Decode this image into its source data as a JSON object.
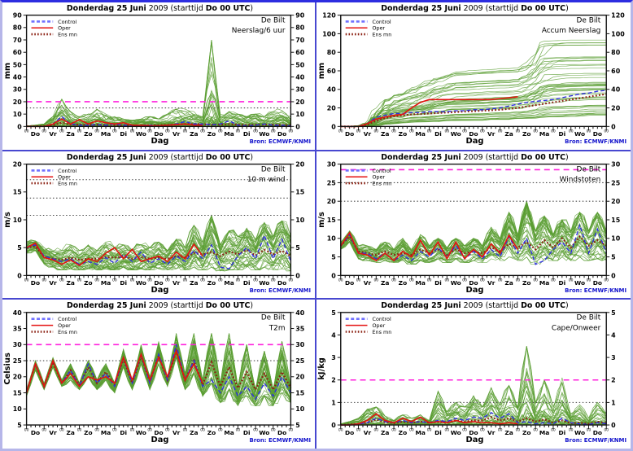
{
  "common": {
    "title_parts": [
      {
        "t": "Donderdag 25 Juni",
        "b": 1
      },
      {
        "t": "   2009  (starttijd  ",
        "b": 0
      },
      {
        "t": "Do 00 ",
        "b": 1
      },
      {
        "t": "UTC",
        "b": 1
      },
      {
        "t": ")",
        "b": 0
      }
    ],
    "location": "De Bilt",
    "legend": [
      {
        "label": "Control",
        "style": "control"
      },
      {
        "label": "Oper",
        "style": "oper"
      },
      {
        "label": "Ens mn",
        "style": "ensmean"
      }
    ],
    "xlabel": "Dag",
    "source": "Bron: ECMWF/KNMI",
    "hour_tick_label": "00",
    "days": [
      "Do",
      "Vr",
      "Za",
      "Zo",
      "Ma",
      "Di",
      "Wo",
      "Do",
      "Vr",
      "Za",
      "Zo",
      "Ma",
      "Di",
      "Wo",
      "Do"
    ],
    "forecast_hours": 360,
    "oper_end_hour": 240,
    "series_step_hours": 12,
    "member_step_hours": 6
  },
  "colors": {
    "ensemble": "#5a9e32",
    "control": "#2e2ee0",
    "control_legend": "#7070ff",
    "oper": "#e41210",
    "ensmean": "#8b2012",
    "magenta_threshold": "#ff22dd",
    "dotted_threshold": "#4a4a4a",
    "axis": "#111111",
    "text": "#000000",
    "source_text": "#1414cc",
    "separator": "#4848d0",
    "border_outer": "#b6b6e9",
    "border_top": "#2d2de0",
    "background": "#ffffff"
  },
  "chart_data": [
    {
      "name": "neerslag-6uur",
      "type": "line",
      "variable": "Neerslag/6 uur",
      "ylabel": "mm",
      "ylim": [
        0,
        90
      ],
      "ystep": 10,
      "magenta_line": 20,
      "dotted_lines": [
        15
      ],
      "skew": 2.4,
      "members": 45,
      "seed": 11,
      "accum": false,
      "control": [
        0,
        0,
        0,
        2,
        8,
        2,
        1,
        1,
        1.5,
        1,
        2,
        1,
        0.5,
        1,
        1,
        0.5,
        1,
        2,
        4,
        2,
        2,
        1.5,
        2,
        4.5,
        1,
        0.5,
        1,
        2,
        1,
        1,
        0.5
      ],
      "oper": [
        0,
        0,
        0,
        2,
        6,
        2,
        5.5,
        2,
        4.5,
        3,
        2,
        3,
        1,
        1,
        0.5,
        0.5,
        1,
        1.5,
        2,
        1,
        1
      ],
      "ensmean": [
        0.2,
        0.2,
        0.3,
        1,
        3,
        1.5,
        1.5,
        1.2,
        1.5,
        1.2,
        1,
        1,
        0.8,
        0.8,
        1,
        1,
        1.2,
        1.5,
        2,
        2,
        1.8,
        1.5,
        1.5,
        1.8,
        1.5,
        1.2,
        1.5,
        1.5,
        1.5,
        1.2,
        1
      ],
      "env_min": null,
      "env_max": [
        0.5,
        1,
        2,
        8,
        22,
        12,
        8,
        10,
        14,
        10,
        8,
        6,
        5,
        6,
        8,
        6,
        10,
        14,
        14,
        12,
        8,
        70,
        10,
        12,
        10,
        8,
        10,
        8,
        12,
        14,
        8
      ]
    },
    {
      "name": "accum-neerslag",
      "type": "line",
      "variable": "Accum Neerslag",
      "ylabel": "mm",
      "ylim": [
        0,
        120
      ],
      "ystep": 20,
      "magenta_line": null,
      "dotted_lines": [],
      "skew": 1,
      "members": 45,
      "seed": 22,
      "accum": true,
      "control": [
        0,
        0,
        0,
        3,
        10,
        12,
        14,
        14,
        15,
        15,
        16,
        16,
        16,
        17,
        17,
        18,
        18,
        19,
        20,
        22,
        24,
        26,
        27,
        28,
        29,
        31,
        33,
        35,
        36,
        38,
        39
      ],
      "oper": [
        0,
        0,
        0,
        3,
        8,
        10,
        12,
        13,
        20,
        26,
        29,
        29,
        29,
        29,
        29,
        29,
        29,
        29,
        30,
        31,
        32
      ],
      "ensmean": [
        0,
        0,
        0,
        2,
        6,
        9,
        11,
        12,
        13,
        13.5,
        14,
        14.5,
        15,
        15.5,
        16,
        16.5,
        17,
        17.5,
        18,
        19,
        20,
        21.5,
        23,
        24.5,
        26,
        27.5,
        29,
        30.5,
        32,
        33.5,
        35
      ],
      "env_min": [
        0,
        0,
        0,
        0,
        1,
        2,
        3,
        3,
        4,
        4,
        4,
        4,
        5,
        5,
        5,
        5,
        5,
        6,
        6,
        6,
        7,
        7,
        7,
        8,
        8,
        8,
        9,
        9,
        10,
        10,
        10
      ],
      "env_max": [
        0,
        0,
        1,
        6,
        20,
        30,
        35,
        38,
        42,
        46,
        50,
        55,
        58,
        60,
        60,
        61,
        62,
        62,
        63,
        63,
        64,
        70,
        80,
        93,
        94,
        94,
        94,
        94,
        94,
        94,
        94
      ]
    },
    {
      "name": "10m-wind",
      "type": "line",
      "variable": "10 m wind",
      "ylabel": "m/s",
      "ylim": [
        0,
        20
      ],
      "ystep": 5,
      "magenta_line": null,
      "dotted_lines": [
        10.8,
        13.9,
        17.2
      ],
      "skew": 1,
      "members": 45,
      "seed": 33,
      "accum": false,
      "control": [
        5,
        5.5,
        3.5,
        3,
        2.5,
        3,
        2,
        2.5,
        2,
        3.2,
        2.2,
        3.8,
        2.5,
        4.2,
        2.2,
        3,
        2,
        3.5,
        2.5,
        4.5,
        3,
        5.5,
        1.5,
        1.2,
        3.5,
        5,
        3,
        7.2,
        3,
        6.5,
        2.5
      ],
      "oper": [
        5,
        5.8,
        3.2,
        2.8,
        2,
        2.8,
        1.8,
        3,
        2.5,
        4,
        5,
        3,
        4.7,
        2.5,
        3,
        3.5,
        2.5,
        4.2,
        3,
        5.6,
        3.5
      ],
      "ensmean": [
        5,
        5.2,
        3.3,
        3,
        2.8,
        3.2,
        2.8,
        3,
        3,
        3.3,
        3.2,
        3.4,
        3,
        3.3,
        3,
        3.2,
        3,
        3.5,
        3.3,
        4,
        3.8,
        4.2,
        3.5,
        4.3,
        3.8,
        4.6,
        3.6,
        4.6,
        3.8,
        4.4,
        3.5
      ],
      "env_min": [
        4,
        4.5,
        2,
        1.5,
        1,
        1.2,
        1,
        1.2,
        1,
        1.2,
        1,
        1.5,
        1,
        1.2,
        1,
        1.2,
        1,
        1.2,
        1,
        1.5,
        1,
        1.5,
        0.8,
        1,
        1,
        1.5,
        1,
        1.5,
        1,
        1.2,
        0.8
      ],
      "env_max": [
        6,
        6.2,
        5,
        4.5,
        4.5,
        5.5,
        4.5,
        5.5,
        4.5,
        6,
        5,
        5.5,
        4.5,
        5.5,
        5,
        6,
        4.5,
        6.5,
        5,
        9,
        6,
        10.8,
        5.5,
        8,
        7,
        8.5,
        6.5,
        9.5,
        7,
        9.8,
        7
      ]
    },
    {
      "name": "windstoten",
      "type": "line",
      "variable": "Windstoten",
      "ylabel": "m/s",
      "ylim": [
        0,
        30
      ],
      "ystep": 5,
      "magenta_line": 28.5,
      "dotted_lines": [
        20,
        25
      ],
      "skew": 1,
      "members": 45,
      "seed": 44,
      "accum": false,
      "control": [
        8,
        11,
        6,
        6,
        4.5,
        6,
        4,
        5.5,
        4,
        6.5,
        5,
        7.5,
        5,
        8,
        4.5,
        6.5,
        4.5,
        7,
        5,
        10.5,
        6,
        10,
        3,
        4,
        7,
        9,
        6,
        13.5,
        6,
        12.5,
        6
      ],
      "oper": [
        8,
        11.5,
        6,
        5.5,
        4,
        6,
        4,
        6.5,
        5,
        9.5,
        5.5,
        9,
        4.5,
        9,
        4.5,
        7,
        5,
        8.5,
        6,
        10.8,
        7
      ],
      "ensmean": [
        8,
        10.5,
        6.5,
        6,
        5.5,
        6.5,
        5.5,
        6,
        5.5,
        7,
        6,
        7,
        5.5,
        7,
        6,
        6.5,
        6,
        7.5,
        6.5,
        8.5,
        7.5,
        9,
        7,
        9.5,
        7.5,
        10,
        7.5,
        10.5,
        8,
        9.5,
        8
      ],
      "env_min": [
        7,
        9,
        4.5,
        4,
        3.5,
        4,
        3.5,
        4,
        3,
        4,
        3.5,
        4.5,
        3.5,
        4.5,
        3.5,
        4,
        3.5,
        4.5,
        4,
        5,
        4,
        5,
        3,
        4,
        4,
        5,
        4,
        5,
        4,
        4.5,
        4
      ],
      "env_max": [
        9,
        12,
        8,
        8,
        7,
        9,
        7,
        10,
        7,
        11,
        8,
        10,
        7.5,
        10,
        8,
        10,
        8,
        13,
        10,
        17,
        11,
        20,
        12,
        16,
        11,
        15,
        12,
        17,
        12,
        17,
        12
      ]
    },
    {
      "name": "t2m",
      "type": "line",
      "variable": "T2m",
      "ylabel": "Celsius",
      "ylim": [
        5,
        40
      ],
      "ystep": 5,
      "magenta_line": 30,
      "dotted_lines": [
        25
      ],
      "skew": 1,
      "members": 45,
      "seed": 55,
      "accum": false,
      "control": [
        15,
        24,
        17,
        25,
        18,
        22,
        17,
        24,
        18,
        21,
        17,
        26,
        18,
        27,
        18,
        27,
        19,
        30,
        19,
        25,
        17,
        19,
        15,
        20,
        14,
        17,
        13,
        18,
        14,
        20,
        15
      ],
      "oper": [
        15,
        24,
        17,
        25,
        18,
        21,
        17,
        20,
        19,
        20,
        18,
        26,
        19,
        27,
        19,
        26,
        20,
        28,
        19,
        24,
        18
      ],
      "ensmean": [
        15,
        24,
        17,
        24.5,
        18,
        22,
        17.5,
        23,
        18,
        21.5,
        17.5,
        25.5,
        18,
        26.5,
        18.5,
        26.5,
        19,
        28,
        19,
        25,
        17.5,
        24.5,
        17,
        23,
        16.5,
        21.5,
        16,
        21,
        16,
        21.5,
        16.5
      ],
      "env_min": [
        14,
        22,
        16,
        23,
        17,
        19,
        16,
        20,
        16,
        19,
        15,
        23,
        16,
        24,
        16,
        24,
        17,
        26,
        16,
        21,
        14,
        18,
        12,
        16,
        11,
        14,
        11,
        14,
        11,
        15,
        12
      ],
      "env_max": [
        16,
        25,
        18,
        26,
        19,
        24,
        18,
        25,
        19,
        24,
        18,
        28.5,
        19,
        30,
        20,
        31,
        20,
        33.5,
        21,
        33.5,
        19,
        33.5,
        18,
        33.5,
        17,
        30,
        16,
        28,
        16,
        31,
        17
      ]
    },
    {
      "name": "cape-onweer",
      "type": "line",
      "variable": "Cape/Onweer",
      "ylabel": "kJ/kg",
      "ylim": [
        0,
        5
      ],
      "ystep": 1,
      "magenta_line": 2,
      "dotted_lines": [
        1
      ],
      "skew": 2.6,
      "members": 45,
      "seed": 66,
      "accum": false,
      "control": [
        0,
        0,
        0.05,
        0.1,
        0.3,
        0.15,
        0.1,
        0.2,
        0.1,
        0.15,
        0.1,
        0.2,
        0.15,
        0.3,
        0.2,
        0.35,
        0.3,
        0.55,
        0.3,
        0.5,
        0.1,
        0.15,
        0.05,
        0.1,
        0.05,
        0.3,
        0.1,
        0.05,
        0.02,
        0.1,
        0.05
      ],
      "oper": [
        0,
        0,
        0.05,
        0.2,
        0.5,
        0.2,
        0.1,
        0.3,
        0.15,
        0.35,
        0.1,
        0.15,
        0.1,
        0.2,
        0.1,
        0.15,
        0.1,
        0.1,
        0.05,
        0.1,
        0.05
      ],
      "ensmean": [
        0,
        0.02,
        0.05,
        0.1,
        0.25,
        0.12,
        0.08,
        0.15,
        0.1,
        0.15,
        0.1,
        0.15,
        0.12,
        0.2,
        0.15,
        0.2,
        0.2,
        0.35,
        0.2,
        0.3,
        0.15,
        0.3,
        0.15,
        0.25,
        0.1,
        0.2,
        0.08,
        0.1,
        0.05,
        0.15,
        0.08
      ],
      "env_min": null,
      "env_max": [
        0.05,
        0.15,
        0.3,
        0.7,
        0.8,
        0.4,
        0.2,
        0.45,
        0.3,
        0.45,
        0.2,
        1.5,
        0.6,
        1.0,
        0.8,
        1.3,
        0.8,
        1.65,
        0.9,
        1.75,
        0.8,
        3.5,
        1.0,
        2.0,
        0.8,
        2.1,
        0.5,
        0.9,
        0.3,
        1.0,
        0.5
      ]
    }
  ]
}
